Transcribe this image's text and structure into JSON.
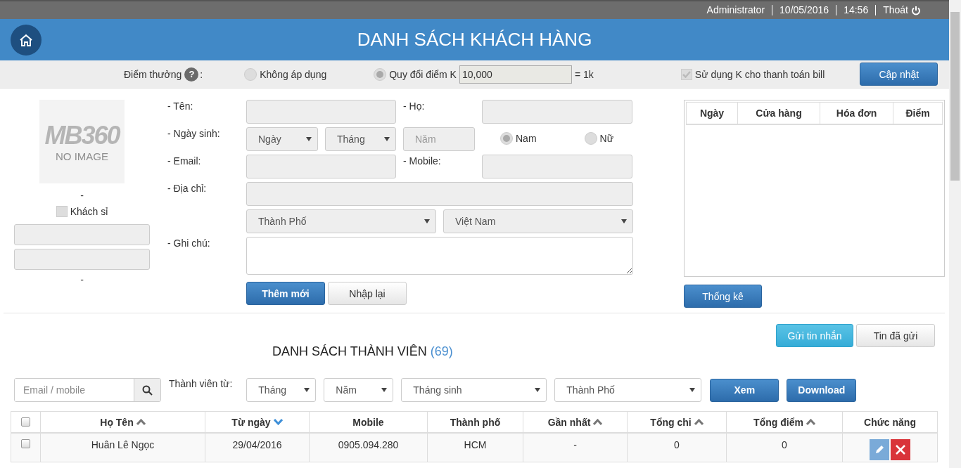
{
  "topbar": {
    "user": "Administrator",
    "date": "10/05/2016",
    "time": "14:56",
    "logout": "Thoát"
  },
  "header": {
    "title": "DANH SÁCH KHÁCH HÀNG"
  },
  "bonus": {
    "label": "Điểm thưởng",
    "help": "?",
    "colon": ":",
    "options": [
      {
        "label": "Không áp dụng",
        "selected": false
      },
      {
        "label": "Quy đổi điểm K",
        "selected": true
      }
    ],
    "rate_value": "10,000",
    "rate_suffix": "= 1k",
    "use_k": {
      "label": "Sử dụng K cho thanh toán bill",
      "checked": true
    },
    "update_button": "Cập nhật"
  },
  "profile": {
    "logo": "MB360",
    "caption": "NO IMAGE",
    "name": "-",
    "wholesale": {
      "label": "Khách sỉ",
      "checked": false
    },
    "code": "-"
  },
  "form": {
    "first_name_label": "- Tên:",
    "last_name_label": "- Họ:",
    "birthday_label": "- Ngày sinh:",
    "day_select": "Ngày",
    "month_select": "Tháng",
    "year_placeholder": "Năm",
    "gender": [
      {
        "label": "Nam",
        "selected": true
      },
      {
        "label": "Nữ",
        "selected": false
      }
    ],
    "email_label": "- Email:",
    "mobile_label": "- Mobile:",
    "address_label": "- Địa chỉ:",
    "city_select": "Thành Phố",
    "country_select": "Việt Nam",
    "note_label": "- Ghi chú:",
    "buttons": [
      {
        "label": "Thêm mới",
        "kind": "primary"
      },
      {
        "label": "Nhập lại",
        "kind": "default"
      }
    ]
  },
  "history": {
    "columns": [
      "Ngày",
      "Cửa hàng",
      "Hóa đơn",
      "Điểm"
    ],
    "stats_button": "Thống kê"
  },
  "members": {
    "message_buttons": [
      {
        "label": "Gửi tin nhắn",
        "kind": "info"
      },
      {
        "label": "Tin đã gửi",
        "kind": "default"
      }
    ],
    "title": "DANH SÁCH THÀNH VIÊN",
    "count": "(69)",
    "search_placeholder": "Email / mobile",
    "filter_label": "Thành viên từ:",
    "filters": [
      "Tháng",
      "Năm",
      "Tháng sinh",
      "Thành Phố"
    ],
    "view_button": "Xem",
    "download_button": "Download",
    "select_all": {
      "checked": false
    },
    "columns": [
      {
        "label": "Họ Tên",
        "sortable": true,
        "active_sort": false
      },
      {
        "label": "Từ ngày",
        "sortable": true,
        "active_sort": true
      },
      {
        "label": "Mobile",
        "sortable": false
      },
      {
        "label": "Thành phố",
        "sortable": false
      },
      {
        "label": "Gần nhất",
        "sortable": true,
        "active_sort": false
      },
      {
        "label": "Tổng chi",
        "sortable": true,
        "active_sort": false
      },
      {
        "label": "Tổng điểm",
        "sortable": true,
        "active_sort": false
      },
      {
        "label": "Chức năng",
        "sortable": false
      }
    ],
    "rows": [
      {
        "checked": false,
        "cells": [
          "Huân Lê Ngọc",
          "29/04/2016",
          "0905.094.280",
          "HCM",
          "-",
          "0",
          "0"
        ]
      }
    ]
  }
}
